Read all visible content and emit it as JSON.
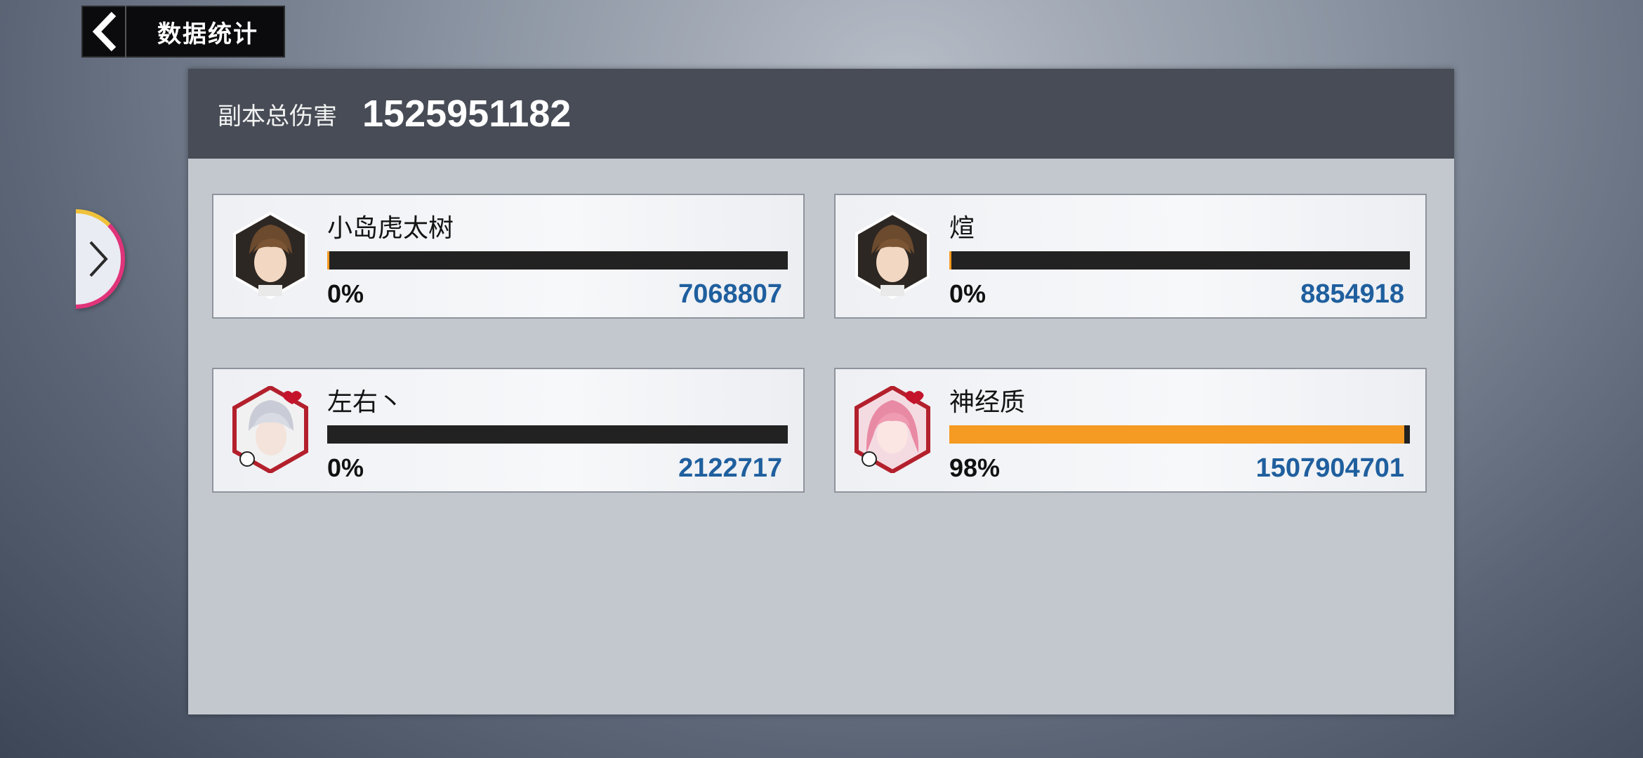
{
  "header": {
    "title": "数据统计"
  },
  "summary": {
    "total_label": "副本总伤害",
    "total_value": "1525951182"
  },
  "players": [
    {
      "name": "小岛虎太树",
      "percent_text": "0%",
      "damage": "7068807",
      "share": 0.005,
      "avatar": "brown-hair-male-avatar-icon"
    },
    {
      "name": "煊",
      "percent_text": "0%",
      "damage": "8854918",
      "share": 0.005,
      "avatar": "brown-hair-male-avatar-icon"
    },
    {
      "name": "左右丶",
      "percent_text": "0%",
      "damage": "2122717",
      "share": 0.0,
      "avatar": "silver-hair-male-avatar-icon"
    },
    {
      "name": "神经质",
      "percent_text": "98%",
      "damage": "1507904701",
      "share": 0.988,
      "avatar": "pink-hair-female-avatar-icon"
    }
  ],
  "colors": {
    "bar_fill": "#f59a23",
    "bar_track": "#222222",
    "damage_text": "#1f5f9e",
    "panel_header": "#474c56"
  }
}
